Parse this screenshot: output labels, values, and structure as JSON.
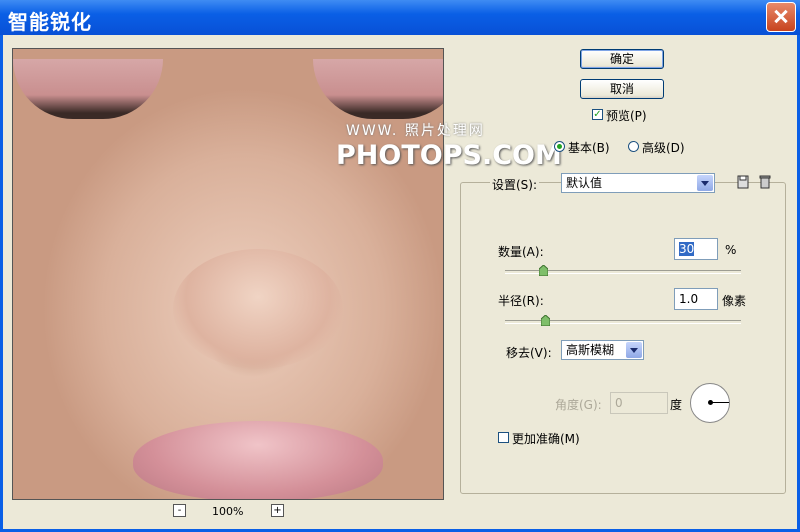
{
  "window": {
    "title": "智能锐化"
  },
  "buttons": {
    "ok": "确定",
    "cancel": "取消"
  },
  "preview_toggle": {
    "label": "预览(P)",
    "checked": true
  },
  "mode": {
    "basic": "基本(B)",
    "advanced": "高级(D)",
    "selected": "basic"
  },
  "settings": {
    "label": "设置(S):",
    "value": "默认值"
  },
  "amount": {
    "label": "数量(A):",
    "value": "30",
    "unit": "%",
    "slider_fraction": 0.16
  },
  "radius": {
    "label": "半径(R):",
    "value": "1.0",
    "unit": "像素",
    "slider_fraction": 0.17
  },
  "remove": {
    "label": "移去(V):",
    "value": "高斯模糊"
  },
  "angle": {
    "label": "角度(G):",
    "value": "0",
    "unit": "度"
  },
  "more_accurate": {
    "label": "更加准确(M)",
    "checked": false
  },
  "zoom": {
    "minus": "-",
    "plus": "+",
    "level": "100%"
  },
  "watermark": {
    "line1": "WWW. 照片处理网",
    "line2": "PHOTOPS.COM"
  }
}
